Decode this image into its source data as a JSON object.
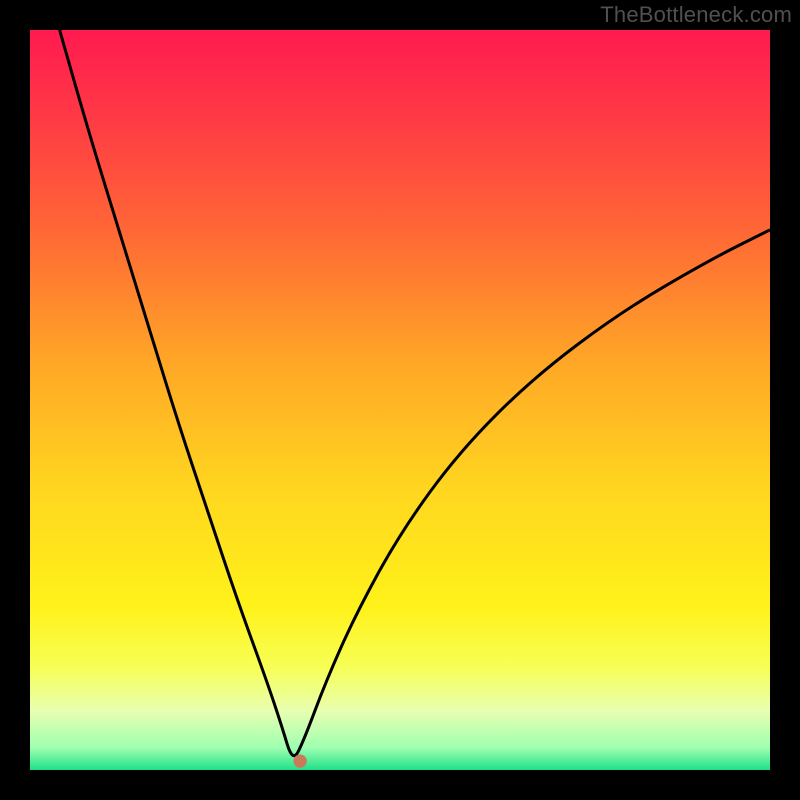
{
  "watermark": "TheBottleneck.com",
  "chart_data": {
    "type": "line",
    "title": "",
    "xlabel": "",
    "ylabel": "",
    "xlim": [
      0,
      100
    ],
    "ylim": [
      0,
      100
    ],
    "grid": false,
    "legend": false,
    "gradient_stops": [
      {
        "pct": 0,
        "color": "#ff1a4f"
      },
      {
        "pct": 12,
        "color": "#ff3a45"
      },
      {
        "pct": 28,
        "color": "#ff6a35"
      },
      {
        "pct": 45,
        "color": "#ffa726"
      },
      {
        "pct": 62,
        "color": "#ffd61f"
      },
      {
        "pct": 78,
        "color": "#fff21a"
      },
      {
        "pct": 86,
        "color": "#f7ff55"
      },
      {
        "pct": 92,
        "color": "#e8ffb0"
      },
      {
        "pct": 97,
        "color": "#9fffb0"
      },
      {
        "pct": 100,
        "color": "#1fe08a"
      }
    ],
    "series": [
      {
        "name": "bottleneck-curve",
        "color": "#000000",
        "x": [
          4,
          8,
          12,
          16,
          20,
          24,
          28,
          32,
          34,
          35.5,
          37,
          40,
          44,
          50,
          58,
          68,
          80,
          92,
          100
        ],
        "y": [
          100,
          86,
          73,
          60,
          47,
          35,
          23,
          12,
          6,
          1,
          4,
          12,
          21,
          32,
          43,
          53,
          62,
          69,
          73
        ]
      }
    ],
    "marker": {
      "x": 36.5,
      "y": 1.2,
      "color": "#c97a5a",
      "radius_pct": 0.9
    },
    "curve_min_x": 35.5
  }
}
